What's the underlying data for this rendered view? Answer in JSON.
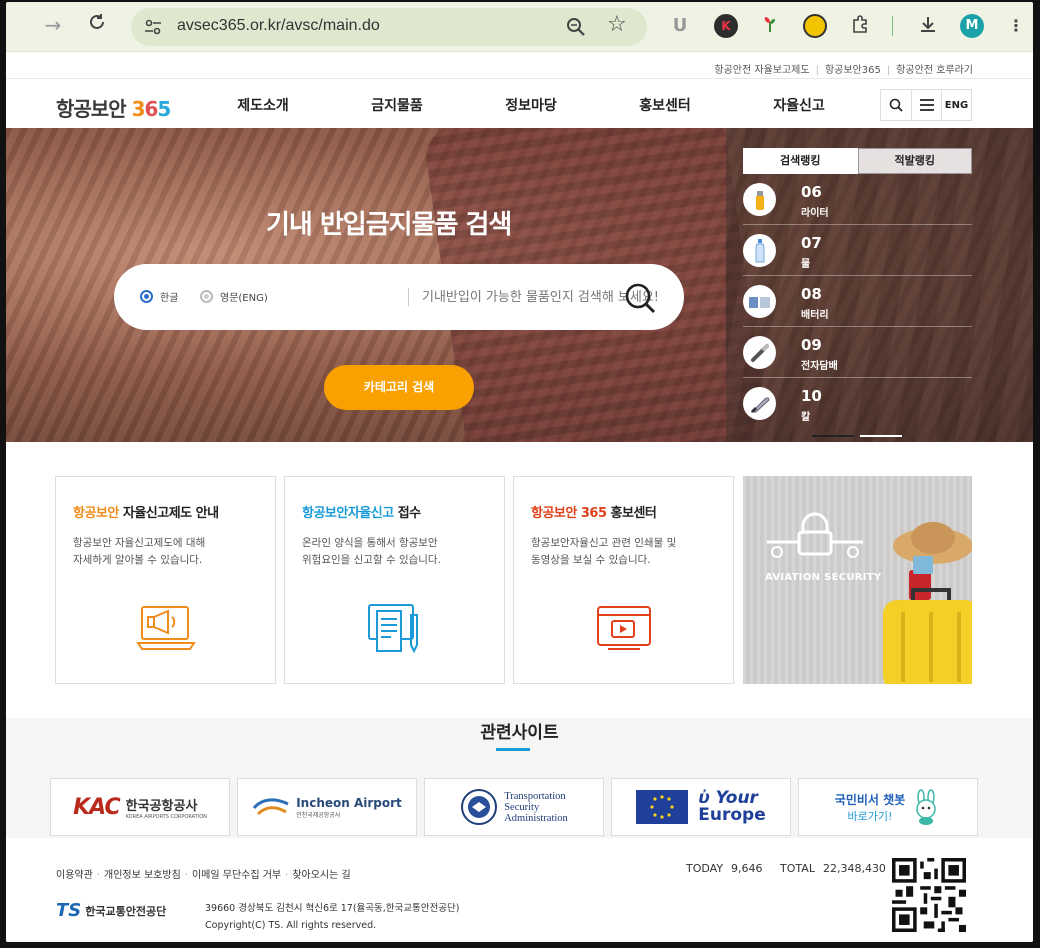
{
  "browser": {
    "url": "avsec365.or.kr/avsc/main.do",
    "avatar_letter": "M",
    "ext_k": "K",
    "ext_u": "U"
  },
  "toplinks": [
    "항공안전 자율보고제도",
    "항공보안365",
    "항공안전 호루라기"
  ],
  "logo": {
    "text": "항공보안",
    "d1": "3",
    "d2": "6",
    "d3": "5"
  },
  "gnb": [
    "제도소개",
    "금지물품",
    "정보마당",
    "홍보센터",
    "자율신고"
  ],
  "header_lang": "ENG",
  "hero": {
    "title": "기내 반입금지물품 검색",
    "radio_ko": "한글",
    "radio_en": "영문(ENG)",
    "search_placeholder": "기내반입이 가능한 물품인지 검색해 보세요!",
    "category_button": "카테고리 검색"
  },
  "ranking": {
    "tab_search": "검색랭킹",
    "tab_seized": "적발랭킹",
    "items": [
      {
        "num": "06",
        "name": "라이터"
      },
      {
        "num": "07",
        "name": "물"
      },
      {
        "num": "08",
        "name": "배터리"
      },
      {
        "num": "09",
        "name": "전자담배"
      },
      {
        "num": "10",
        "name": "칼"
      }
    ]
  },
  "cards": [
    {
      "title_accent": "항공보안",
      "title_rest": " 자율신고제도 안내",
      "desc": "항공보안 자율신고제도에 대해\n자세하게 알아볼 수 있습니다.",
      "accent_color": "#f08c1c"
    },
    {
      "title_accent": "항공보안자율신고",
      "title_rest": " 접수",
      "desc": "온라인 양식을 통해서 항공보안\n위험요인을 신고할 수 있습니다.",
      "accent_color": "#1a9bd7"
    },
    {
      "title_accent": "항공보안 365",
      "title_rest": " 홍보센터",
      "desc": "항공보안자율신고 관련 인쇄물 및\n동영상을 보실 수 있습니다.",
      "accent_color": "#e0401a"
    }
  ],
  "photo_text": "AVIATION SECURITY",
  "related": {
    "title": "관련사이트",
    "kac_mark": "KAC",
    "kac_name": "한국공항공사",
    "kac_sub": "KOREA AIRPORTS CORPORATION",
    "incheon_name": "Incheon Airport",
    "incheon_sub": "인천국제공항공사",
    "tsa_line1": "Transportation",
    "tsa_line2": "Security",
    "tsa_line3": "Administration",
    "eu_line1": "Your",
    "eu_line2": "Europe",
    "chatbot_line1": "국민비서 챗봇",
    "chatbot_line2": "바로가기!"
  },
  "footer": {
    "links": [
      "이용약관",
      "개인정보 보호방침",
      "이메일 무단수집 거부",
      "찾아오시는 길"
    ],
    "today_label": "TODAY",
    "today_value": "9,646",
    "total_label": "TOTAL",
    "total_value": "22,348,430",
    "ts_mark": "TS",
    "ts_name": "한국교통안전공단",
    "address": "39660 경상북도 김천시 혁신6로 17(율곡동,한국교통안전공단)",
    "copyright": "Copyright(C) TS. All rights reserved."
  },
  "colors": {
    "orange": "#f8a100",
    "blue": "#1a9bd7",
    "red": "#e0401a"
  }
}
